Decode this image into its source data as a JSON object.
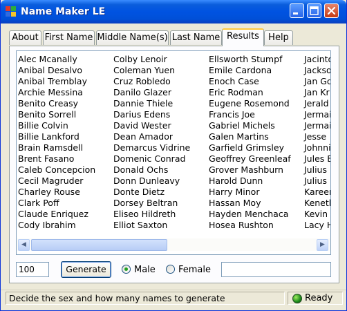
{
  "window": {
    "title": "Name Maker LE",
    "icons": {
      "app": "app-grid-icon",
      "minimize": "minimize-icon",
      "maximize": "maximize-icon",
      "close": "close-icon"
    }
  },
  "tabs": [
    {
      "label": "About"
    },
    {
      "label": "First Name"
    },
    {
      "label": "Middle Name(s)"
    },
    {
      "label": "Last Name"
    },
    {
      "label": "Results",
      "active": true
    },
    {
      "label": "Help"
    }
  ],
  "results": {
    "columns": [
      [
        "Alec Mcanally",
        "Anibal Desalvo",
        "Anibal Tremblay",
        "Archie Messina",
        "Benito Creasy",
        "Benito Sorrell",
        "Billie Colvin",
        "Billie Lankford",
        "Brain Ramsdell",
        "Brent Fasano",
        "Caleb Concepcion",
        "Cecil Magruder",
        "Charley Rouse",
        "Clark Poff",
        "Claude Enriquez",
        "Cody Ibrahim"
      ],
      [
        "Colby Lenoir",
        "Coleman Yuen",
        "Cruz Robledo",
        "Danilo Glazer",
        "Dannie Thiele",
        "Darius Edens",
        "David Wester",
        "Dean Amador",
        "Demarcus Vidrine",
        "Domenic Conrad",
        "Donald Ochs",
        "Donn Dunleavy",
        "Donte Dietz",
        "Dorsey Beltran",
        "Eliseo Hildreth",
        "Elliot Saxton"
      ],
      [
        "Ellsworth Stumpf",
        "Emile Cardona",
        "Enoch Case",
        "Eric Rodman",
        "Eugene Rosemond",
        "Francis Joe",
        "Gabriel Michels",
        "Galen Martins",
        "Garfield Grimsley",
        "Geoffrey Greenleaf",
        "Grover Mashburn",
        "Harold Dunn",
        "Harry Minor",
        "Hassan Moy",
        "Hayden Menchaca",
        "Hosea Rushton"
      ],
      [
        "Jacinto",
        "Jackson",
        "Jan Go",
        "Jan Kr",
        "Jerald",
        "Jermai",
        "Jermai",
        "Jesse",
        "Johnni",
        "Jules E",
        "Julius",
        "Julius",
        "Kareem",
        "Kenethi",
        "Kevin S",
        "Lacy H"
      ]
    ],
    "scrollbar": {
      "left_icon": "scroll-left-icon",
      "right_icon": "scroll-right-icon",
      "left_glyph": "◀",
      "right_glyph": "▶"
    }
  },
  "controls": {
    "quantity_value": "100",
    "generate_label": "Generate",
    "sex_options": [
      {
        "label": "Male",
        "selected": true
      },
      {
        "label": "Female",
        "selected": false
      }
    ],
    "output_value": ""
  },
  "status": {
    "message": "Decide the sex and how many names to generate",
    "state": "Ready",
    "state_icon": "ready-status-icon"
  },
  "colors": {
    "title_bar": "#0053e1",
    "active_tab_accent": "#ffc83c",
    "radio_selected": "#21a121",
    "ready_indicator": "#1b8a1b"
  }
}
